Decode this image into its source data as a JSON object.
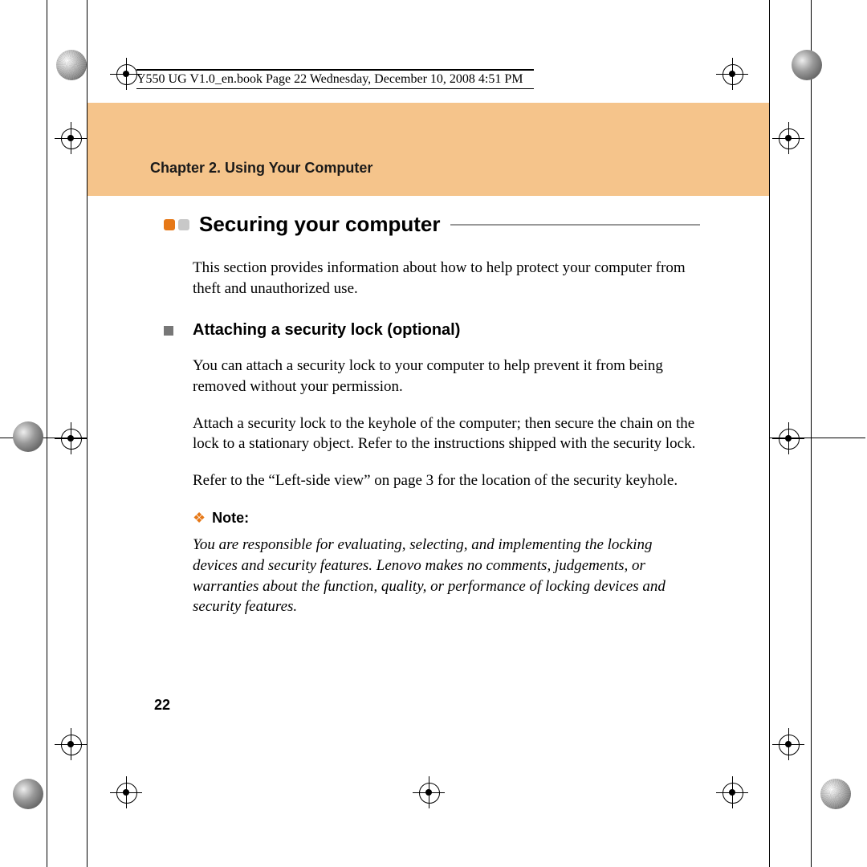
{
  "header": {
    "file_info": "Y550 UG V1.0_en.book  Page 22  Wednesday, December 10, 2008  4:51 PM"
  },
  "chapter": {
    "title": "Chapter 2. Using Your Computer"
  },
  "section": {
    "title": "Securing your computer",
    "intro": "This section provides information about how to help protect your computer from theft and unauthorized use."
  },
  "subsection": {
    "title": "Attaching a security lock (optional)",
    "p1": "You can attach a security lock to your computer to help prevent it from being removed without your permission.",
    "p2": "Attach a security lock to the keyhole of the computer; then secure the chain on the lock to a stationary object. Refer to the instructions shipped with the security lock.",
    "p3": "Refer to the “Left-side view” on page 3 for the location of the security keyhole."
  },
  "note": {
    "label": "Note:",
    "text": "You are responsible for evaluating, selecting, and implementing the locking devices and security features. Lenovo makes no comments, judgements, or warranties about the function, quality, or performance of locking devices and security features."
  },
  "page_number": "22"
}
